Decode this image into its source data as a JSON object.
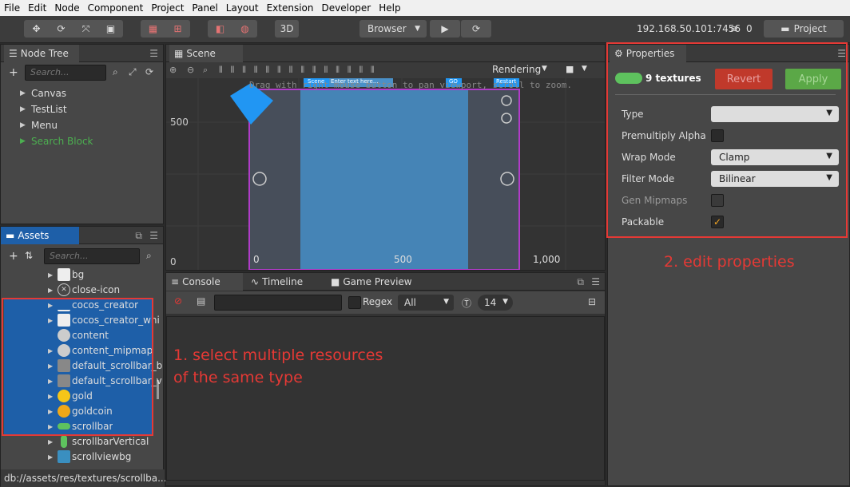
{
  "menu": [
    "File",
    "Edit",
    "Node",
    "Component",
    "Project",
    "Panel",
    "Layout",
    "Extension",
    "Developer",
    "Help"
  ],
  "toolbar": {
    "three_d": "3D",
    "browser": "Browser",
    "ip": "192.168.50.101:7456",
    "count": "0",
    "project": "Project"
  },
  "node_tree": {
    "title": "Node Tree",
    "search": "Search...",
    "items": [
      "Canvas",
      "TestList",
      "Menu",
      "Search Block"
    ]
  },
  "assets": {
    "title": "Assets",
    "search": "Search...",
    "items": [
      "bg",
      "close-icon",
      "cocos_creator",
      "cocos_creator_whi",
      "content",
      "content_mipmap",
      "default_scrollbar_b",
      "default_scrollbar_v",
      "gold",
      "goldcoin",
      "scrollbar",
      "scrollbarVertical",
      "scrollviewbg"
    ],
    "path": "db://assets/res/textures/scrollba..."
  },
  "scene": {
    "title": "Scene",
    "rendering": "Rendering",
    "hint": "Drag with right mouse button to pan viewport, scroll to zoom.",
    "y500": "500",
    "y0": "0",
    "x0": "0",
    "x500": "500",
    "x1000": "1,000",
    "scene_btn": "Scene",
    "input": "Enter text here...",
    "go": "GO",
    "restart": "Restart"
  },
  "console": {
    "tab_console": "Console",
    "tab_timeline": "Timeline",
    "tab_game": "Game Preview",
    "regex": "Regex",
    "filter": "All",
    "font_size": "14"
  },
  "properties": {
    "title": "Properties",
    "name": "9 textures",
    "revert": "Revert",
    "apply": "Apply",
    "rows": [
      {
        "label": "Type",
        "value": ""
      },
      {
        "label": "Premultiply Alpha"
      },
      {
        "label": "Wrap Mode",
        "value": "Clamp"
      },
      {
        "label": "Filter Mode",
        "value": "Bilinear"
      },
      {
        "label": "Gen Mipmaps"
      },
      {
        "label": "Packable"
      }
    ]
  },
  "annotations": {
    "a1_l1": "1. select multiple resources",
    "a1_l2": "of the same type",
    "a2": "2. edit properties"
  }
}
